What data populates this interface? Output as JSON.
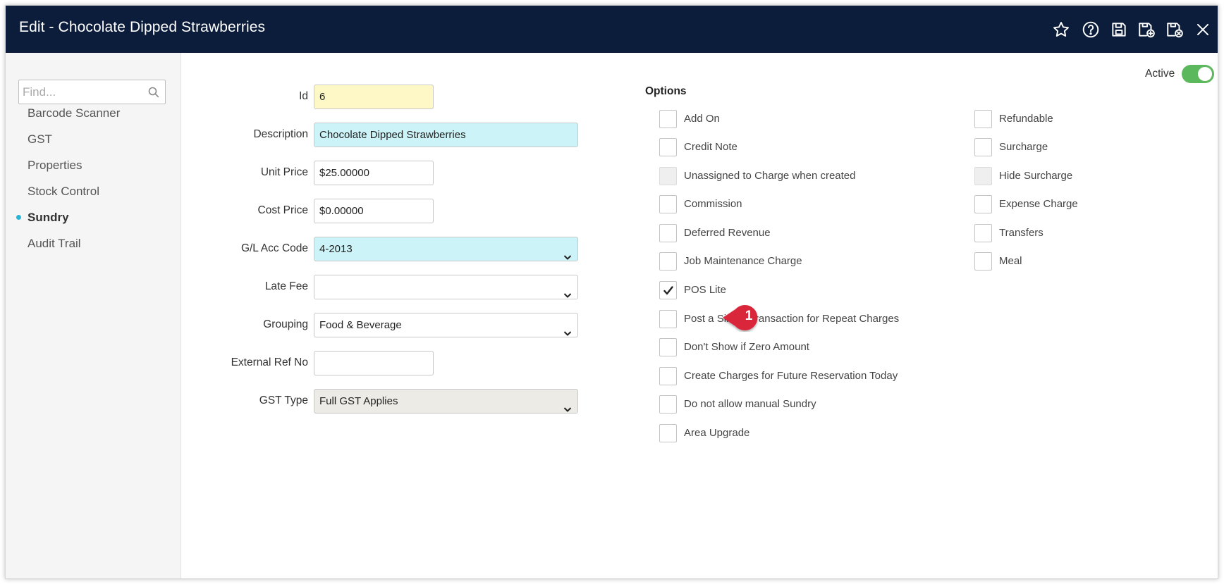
{
  "window": {
    "title": "Edit - Chocolate Dipped Strawberries",
    "header_bg": "#0c1d3b"
  },
  "toolbar": {
    "icons": [
      "star-icon",
      "help-icon",
      "save-icon",
      "save-new-icon",
      "save-close-icon",
      "close-icon"
    ]
  },
  "sidebar": {
    "search_placeholder": "Find...",
    "items": [
      {
        "label": "Barcode Scanner",
        "active": false
      },
      {
        "label": "GST",
        "active": false
      },
      {
        "label": "Properties",
        "active": false
      },
      {
        "label": "Stock Control",
        "active": false
      },
      {
        "label": "Sundry",
        "active": true
      },
      {
        "label": "Audit Trail",
        "active": false
      }
    ],
    "active_dot_color": "#29b6d6"
  },
  "form": {
    "id": {
      "label": "Id",
      "value": "6"
    },
    "description": {
      "label": "Description",
      "value": "Chocolate Dipped Strawberries"
    },
    "unit_price": {
      "label": "Unit Price",
      "value": "$25.00000"
    },
    "cost_price": {
      "label": "Cost Price",
      "value": "$0.00000"
    },
    "gl_acc_code": {
      "label": "G/L Acc Code",
      "value": "4-2013"
    },
    "late_fee": {
      "label": "Late Fee",
      "value": ""
    },
    "grouping": {
      "label": "Grouping",
      "value": "Food & Beverage"
    },
    "external_ref_no": {
      "label": "External Ref No",
      "value": ""
    },
    "gst_type": {
      "label": "GST Type",
      "value": "Full GST Applies"
    }
  },
  "options": {
    "title": "Options",
    "left": [
      {
        "label": "Add On",
        "checked": false,
        "disabled": false
      },
      {
        "label": "Credit Note",
        "checked": false,
        "disabled": false
      },
      {
        "label": "Unassigned to Charge when created",
        "checked": false,
        "disabled": true
      },
      {
        "label": "Commission",
        "checked": false,
        "disabled": false
      },
      {
        "label": "Deferred Revenue",
        "checked": false,
        "disabled": false
      },
      {
        "label": "Job Maintenance Charge",
        "checked": false,
        "disabled": false
      },
      {
        "label": "POS Lite",
        "checked": true,
        "disabled": false
      },
      {
        "label": "Post a Single Transaction for Repeat Charges",
        "checked": false,
        "disabled": false
      },
      {
        "label": "Don't Show if Zero Amount",
        "checked": false,
        "disabled": false
      },
      {
        "label": "Create Charges for Future Reservation Today",
        "checked": false,
        "disabled": false
      },
      {
        "label": "Do not allow manual Sundry",
        "checked": false,
        "disabled": false
      },
      {
        "label": "Area Upgrade",
        "checked": false,
        "disabled": false
      }
    ],
    "right": [
      {
        "label": "Refundable",
        "checked": false,
        "disabled": false
      },
      {
        "label": "Surcharge",
        "checked": false,
        "disabled": false
      },
      {
        "label": "Hide Surcharge",
        "checked": false,
        "disabled": true
      },
      {
        "label": "Expense Charge",
        "checked": false,
        "disabled": false
      },
      {
        "label": "Transfers",
        "checked": false,
        "disabled": false
      },
      {
        "label": "Meal",
        "checked": false,
        "disabled": false
      }
    ]
  },
  "active_toggle": {
    "label": "Active",
    "on": true,
    "color": "#5cb85c"
  },
  "callout": {
    "number": "1",
    "color": "#d9263a"
  }
}
